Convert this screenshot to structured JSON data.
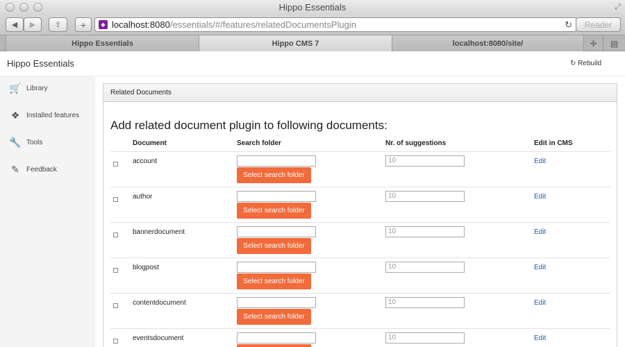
{
  "window": {
    "title": "Hippo Essentials"
  },
  "toolbar": {
    "url_host": "localhost:8080",
    "url_path": "/essentials/#/features/relatedDocumentsPlugin",
    "reader_label": "Reader"
  },
  "tabs": [
    {
      "label": "Hippo Essentials"
    },
    {
      "label": "Hippo CMS 7"
    },
    {
      "label": "localhost:8080/site/"
    }
  ],
  "app": {
    "brand": "Hippo Essentials",
    "rebuild_label": "Rebuild"
  },
  "sidebar": {
    "items": [
      {
        "label": "Library",
        "icon": "cart-icon"
      },
      {
        "label": "Installed features",
        "icon": "dropbox-icon"
      },
      {
        "label": "Tools",
        "icon": "wrench-icon"
      },
      {
        "label": "Feedback",
        "icon": "pencil-icon"
      }
    ]
  },
  "panel": {
    "heading": "Related Documents",
    "title": "Add related document plugin to following documents:",
    "columns": {
      "document": "Document",
      "search_folder": "Search folder",
      "suggestions": "Nr. of suggestions",
      "edit": "Edit in CMS"
    },
    "select_button_label": "Select search folder",
    "edit_label": "Edit",
    "rows": [
      {
        "name": "account",
        "suggestions": "10"
      },
      {
        "name": "author",
        "suggestions": "10"
      },
      {
        "name": "bannerdocument",
        "suggestions": "10"
      },
      {
        "name": "blogpost",
        "suggestions": "10"
      },
      {
        "name": "contentdocument",
        "suggestions": "10"
      },
      {
        "name": "eventsdocument",
        "suggestions": "10"
      }
    ]
  },
  "colors": {
    "accent": "#f26b3a",
    "link": "#1a5aa8"
  }
}
